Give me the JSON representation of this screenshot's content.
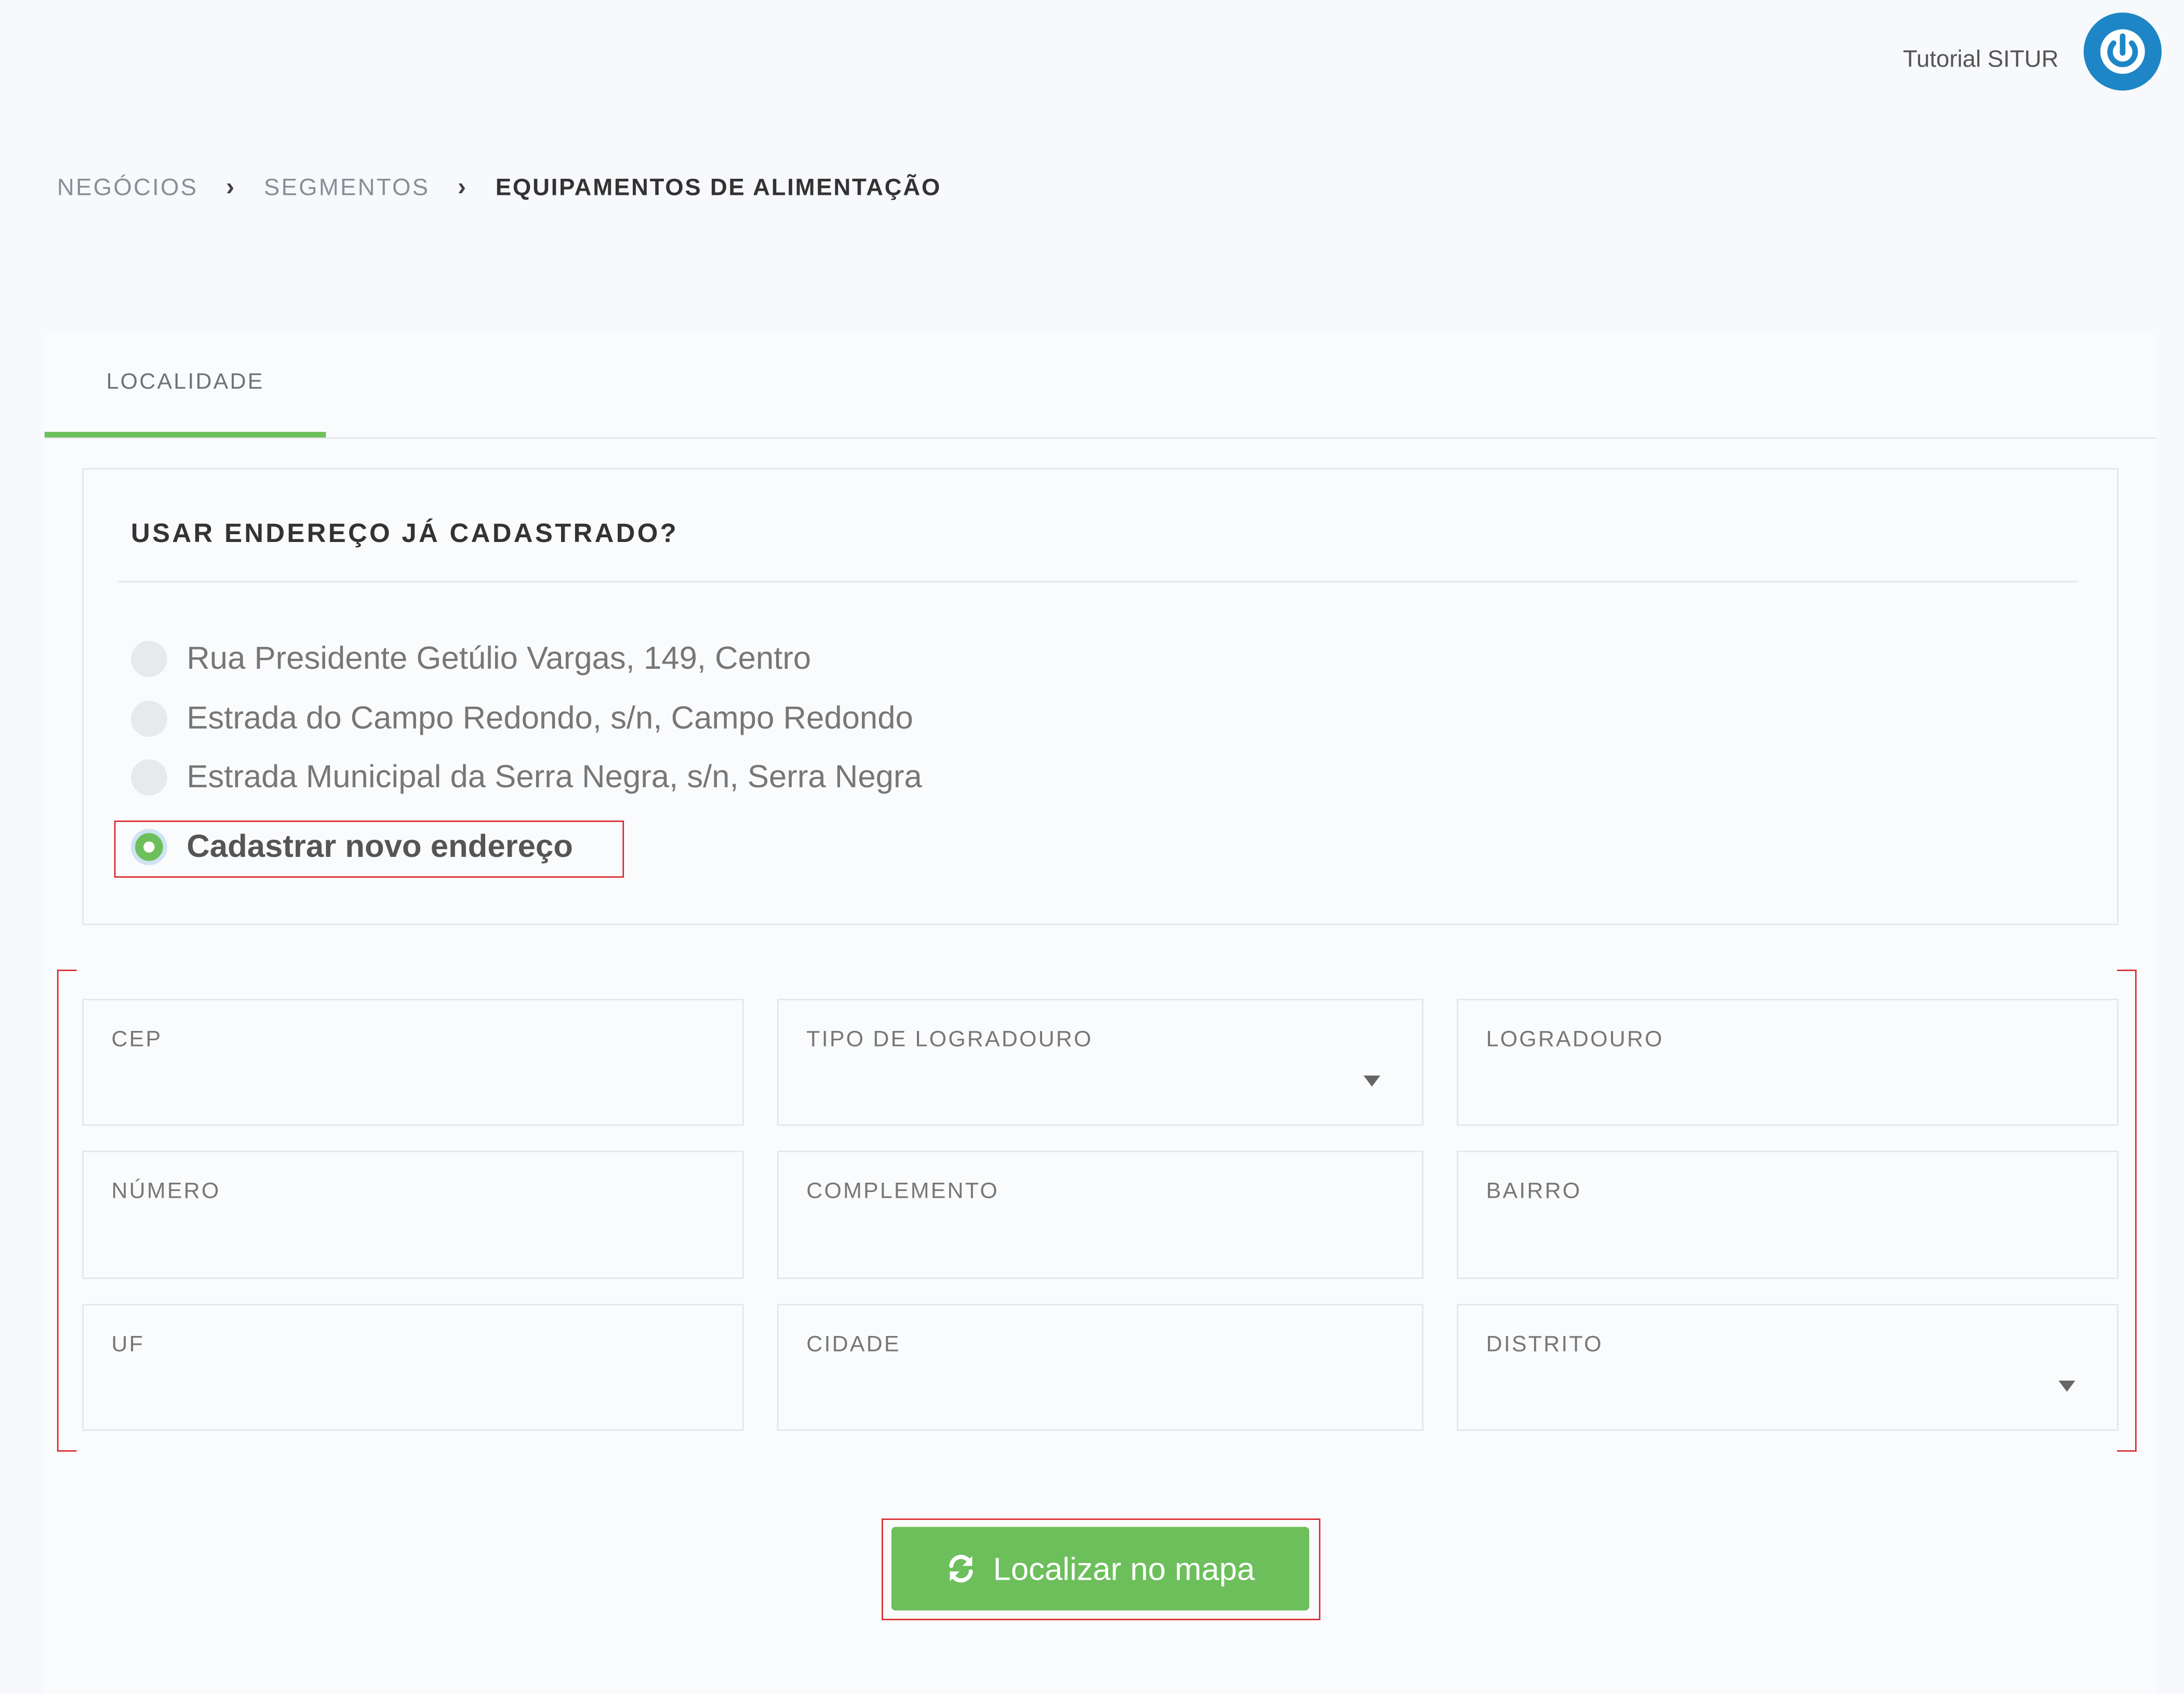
{
  "header": {
    "user_label": "Tutorial SITUR"
  },
  "breadcrumb": {
    "items": [
      "NEGÓCIOS",
      "SEGMENTOS",
      "EQUIPAMENTOS DE ALIMENTAÇÃO"
    ]
  },
  "tabs": {
    "active": "LOCALIDADE"
  },
  "address_section": {
    "title": "USAR ENDEREÇO JÁ CADASTRADO?",
    "options": [
      "Rua Presidente Getúlio Vargas, 149, Centro",
      "Estrada do Campo Redondo, s/n, Campo Redondo",
      "Estrada Municipal da Serra Negra, s/n, Serra Negra",
      "Cadastrar novo endereço"
    ],
    "selected_option": "Cadastrar novo endereço"
  },
  "form": {
    "cep": "CEP",
    "tipo_logradouro": "TIPO DE LOGRADOURO",
    "logradouro": "LOGRADOURO",
    "numero": "NÚMERO",
    "complemento": "COMPLEMENTO",
    "bairro": "BAIRRO",
    "uf": "UF",
    "cidade": "CIDADE",
    "distrito": "DISTRITO"
  },
  "actions": {
    "locate_label": "Localizar no mapa"
  },
  "colors": {
    "accent_green": "#6cbf5b",
    "power_blue": "#1e86c6",
    "highlight_red": "#d9262a"
  }
}
